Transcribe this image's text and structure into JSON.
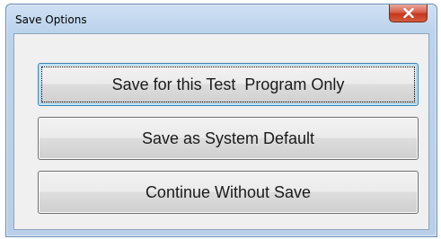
{
  "window": {
    "title": "Save Options"
  },
  "buttons": {
    "save_test_program": "Save for this Test  Program Only",
    "save_system_default": "Save as System Default",
    "continue_without_save": "Continue Without Save"
  },
  "colors": {
    "close_button": "#c7361d",
    "frame": "#b9cfe8",
    "client_background": "#f0f0f0",
    "default_button_border": "#3c7fb1"
  },
  "icons": {
    "close": "close-icon"
  }
}
